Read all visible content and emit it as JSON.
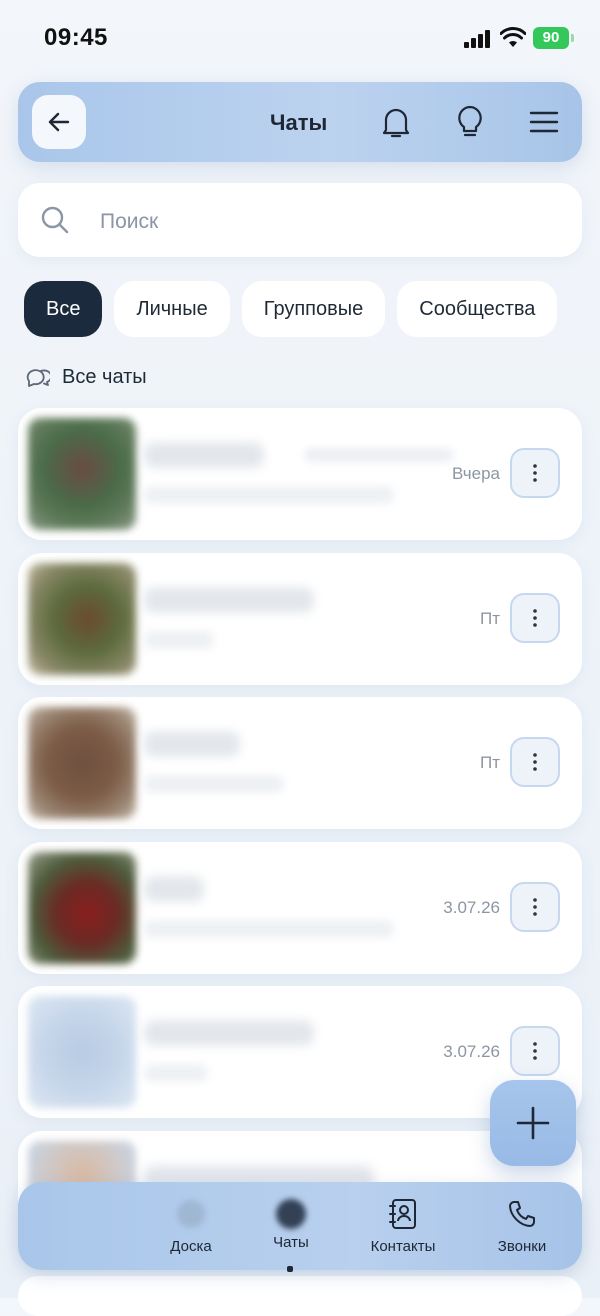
{
  "status_bar": {
    "time": "09:45",
    "battery": "90"
  },
  "header": {
    "title": "Чаты"
  },
  "search": {
    "placeholder": "Поиск"
  },
  "filters": [
    {
      "label": "Все",
      "active": true
    },
    {
      "label": "Личные",
      "active": false
    },
    {
      "label": "Групповые",
      "active": false
    },
    {
      "label": "Сообщества",
      "active": false
    }
  ],
  "section": {
    "label": "Все чаты"
  },
  "chats": [
    {
      "time": "Вчера"
    },
    {
      "time": "Пт"
    },
    {
      "time": "Пт"
    },
    {
      "time": "3.07.26"
    },
    {
      "time": "3.07.26"
    }
  ],
  "nav": {
    "board": "Доска",
    "chats": "Чаты",
    "contacts": "Контакты",
    "calls": "Звонки"
  },
  "colors": {
    "accent": "#a9c6ea",
    "active_chip": "#1c2a3d",
    "battery": "#34c759"
  }
}
